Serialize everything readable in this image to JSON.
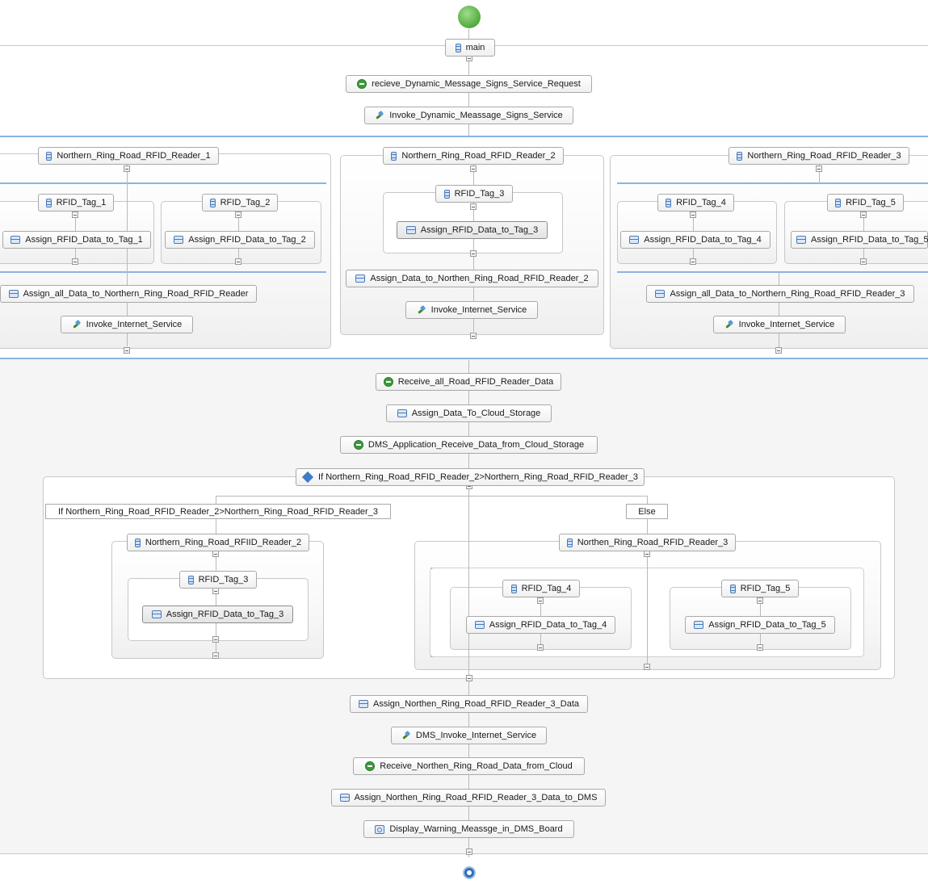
{
  "process": {
    "main": "main",
    "receive_request": "recieve_Dynamic_Message_Signs_Service_Request",
    "invoke_dms": "Invoke_Dynamic_Meassage_Signs_Service",
    "reader1": {
      "title": "Northern_Ring_Road_RFID_Reader_1",
      "tag1": "RFID_Tag_1",
      "tag1_assign": "Assign_RFID_Data_to_Tag_1",
      "tag2": "RFID_Tag_2",
      "tag2_assign": "Assign_RFID_Data_to_Tag_2",
      "assign_all": "Assign_all_Data_to_Northern_Ring_Road_RFID_Reader",
      "invoke": "Invoke_Internet_Service"
    },
    "reader2": {
      "title": "Northern_Ring_Road_RFID_Reader_2",
      "tag3": "RFID_Tag_3",
      "tag3_assign": "Assign_RFID_Data_to_Tag_3",
      "assign_all": "Assign_Data_to_Northen_Ring_Road_RFID_Reader_2",
      "invoke": "Invoke_Internet_Service"
    },
    "reader3": {
      "title": "Northern_Ring_Road_RFID_Reader_3",
      "tag4": "RFID_Tag_4",
      "tag4_assign": "Assign_RFID_Data_to_Tag_4",
      "tag5": "RFID_Tag_5",
      "tag5_assign": "Assign_RFID_Data_to_Tag_5",
      "assign_all": "Assign_all_Data_to_Northern_Ring_Road_RFID_Reader_3",
      "invoke": "Invoke_Internet_Service"
    },
    "receive_all": "Receive_all_Road_RFID_Reader_Data",
    "assign_cloud": "Assign_Data_To_Cloud_Storage",
    "dms_receive": "DMS_Application_Receive_Data_from_Cloud_Storage",
    "if_label": "If Northern_Ring_Road_RFID_Reader_2>Northern_Ring_Road_RFID_Reader_3",
    "if_branch_label": "If Northern_Ring_Road_RFID_Reader_2>Northern_Ring_Road_RFID_Reader_3",
    "else_label": "Else",
    "if_branch": {
      "title": "Northern_Ring_Road_RFIID_Reader_2",
      "tag3": "RFID_Tag_3",
      "tag3_assign": "Assign_RFID_Data_to_Tag_3"
    },
    "else_branch": {
      "title": "Northen_Ring_Road_RFID_Reader_3",
      "tag4": "RFID_Tag_4",
      "tag4_assign": "Assign_RFID_Data_to_Tag_4",
      "tag5": "RFID_Tag_5",
      "tag5_assign": "Assign_RFID_Data_to_Tag_5"
    },
    "assign_reader3": "Assign_Northen_Ring_Road_RFID_Reader_3_Data",
    "dms_invoke": "DMS_Invoke_Internet_Service",
    "receive_cloud": "Receive_Northen_Ring_Road_Data_from_Cloud",
    "assign_dms": "Assign_Northen_Ring_Road_RFID_Reader_3_Data_to_DMS",
    "display": "Display_Warning_Meassge_in_DMS_Board"
  },
  "colors": {
    "accent": "#8db3e2",
    "start": "#5fb64a",
    "end": "#2f6fb8"
  }
}
